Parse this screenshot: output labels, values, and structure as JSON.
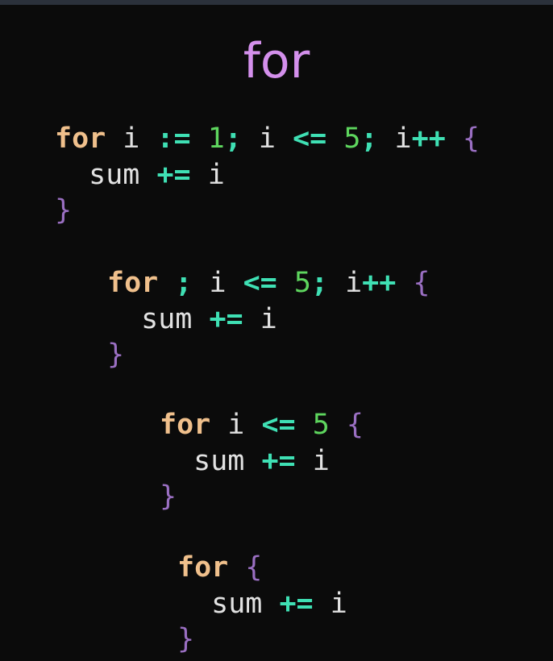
{
  "title": "for",
  "colors": {
    "keyword": "#f0c08c",
    "operator": "#3fe0b4",
    "number": "#5ed65e",
    "brace": "#9a6fc2",
    "identifier": "#e2e2e2",
    "title": "#d490ec"
  },
  "blocks": [
    {
      "lines": [
        [
          [
            "kw",
            "for"
          ],
          [
            "ws",
            " "
          ],
          [
            "id",
            "i"
          ],
          [
            "ws",
            " "
          ],
          [
            "op",
            ":="
          ],
          [
            "ws",
            " "
          ],
          [
            "num",
            "1"
          ],
          [
            "op",
            ";"
          ],
          [
            "ws",
            " "
          ],
          [
            "id",
            "i"
          ],
          [
            "ws",
            " "
          ],
          [
            "op",
            "<="
          ],
          [
            "ws",
            " "
          ],
          [
            "num",
            "5"
          ],
          [
            "op",
            ";"
          ],
          [
            "ws",
            " "
          ],
          [
            "id",
            "i"
          ],
          [
            "op",
            "++"
          ],
          [
            "ws",
            " "
          ],
          [
            "br",
            "{"
          ]
        ],
        [
          [
            "ws",
            "  "
          ],
          [
            "id",
            "sum"
          ],
          [
            "ws",
            " "
          ],
          [
            "op",
            "+="
          ],
          [
            "ws",
            " "
          ],
          [
            "id",
            "i"
          ]
        ],
        [
          [
            "br",
            "}"
          ]
        ]
      ]
    },
    {
      "lines": [
        [
          [
            "kw",
            "for"
          ],
          [
            "ws",
            " "
          ],
          [
            "op",
            ";"
          ],
          [
            "ws",
            " "
          ],
          [
            "id",
            "i"
          ],
          [
            "ws",
            " "
          ],
          [
            "op",
            "<="
          ],
          [
            "ws",
            " "
          ],
          [
            "num",
            "5"
          ],
          [
            "op",
            ";"
          ],
          [
            "ws",
            " "
          ],
          [
            "id",
            "i"
          ],
          [
            "op",
            "++"
          ],
          [
            "ws",
            " "
          ],
          [
            "br",
            "{"
          ]
        ],
        [
          [
            "ws",
            "  "
          ],
          [
            "id",
            "sum"
          ],
          [
            "ws",
            " "
          ],
          [
            "op",
            "+="
          ],
          [
            "ws",
            " "
          ],
          [
            "id",
            "i"
          ]
        ],
        [
          [
            "br",
            "}"
          ]
        ]
      ]
    },
    {
      "lines": [
        [
          [
            "kw",
            "for"
          ],
          [
            "ws",
            " "
          ],
          [
            "id",
            "i"
          ],
          [
            "ws",
            " "
          ],
          [
            "op",
            "<="
          ],
          [
            "ws",
            " "
          ],
          [
            "num",
            "5"
          ],
          [
            "ws",
            " "
          ],
          [
            "br",
            "{"
          ]
        ],
        [
          [
            "ws",
            "  "
          ],
          [
            "id",
            "sum"
          ],
          [
            "ws",
            " "
          ],
          [
            "op",
            "+="
          ],
          [
            "ws",
            " "
          ],
          [
            "id",
            "i"
          ]
        ],
        [
          [
            "br",
            "}"
          ]
        ]
      ]
    },
    {
      "lines": [
        [
          [
            "kw",
            "for"
          ],
          [
            "ws",
            " "
          ],
          [
            "br",
            "{"
          ]
        ],
        [
          [
            "ws",
            "  "
          ],
          [
            "id",
            "sum"
          ],
          [
            "ws",
            " "
          ],
          [
            "op",
            "+="
          ],
          [
            "ws",
            " "
          ],
          [
            "id",
            "i"
          ]
        ],
        [
          [
            "br",
            "}"
          ]
        ]
      ]
    }
  ]
}
